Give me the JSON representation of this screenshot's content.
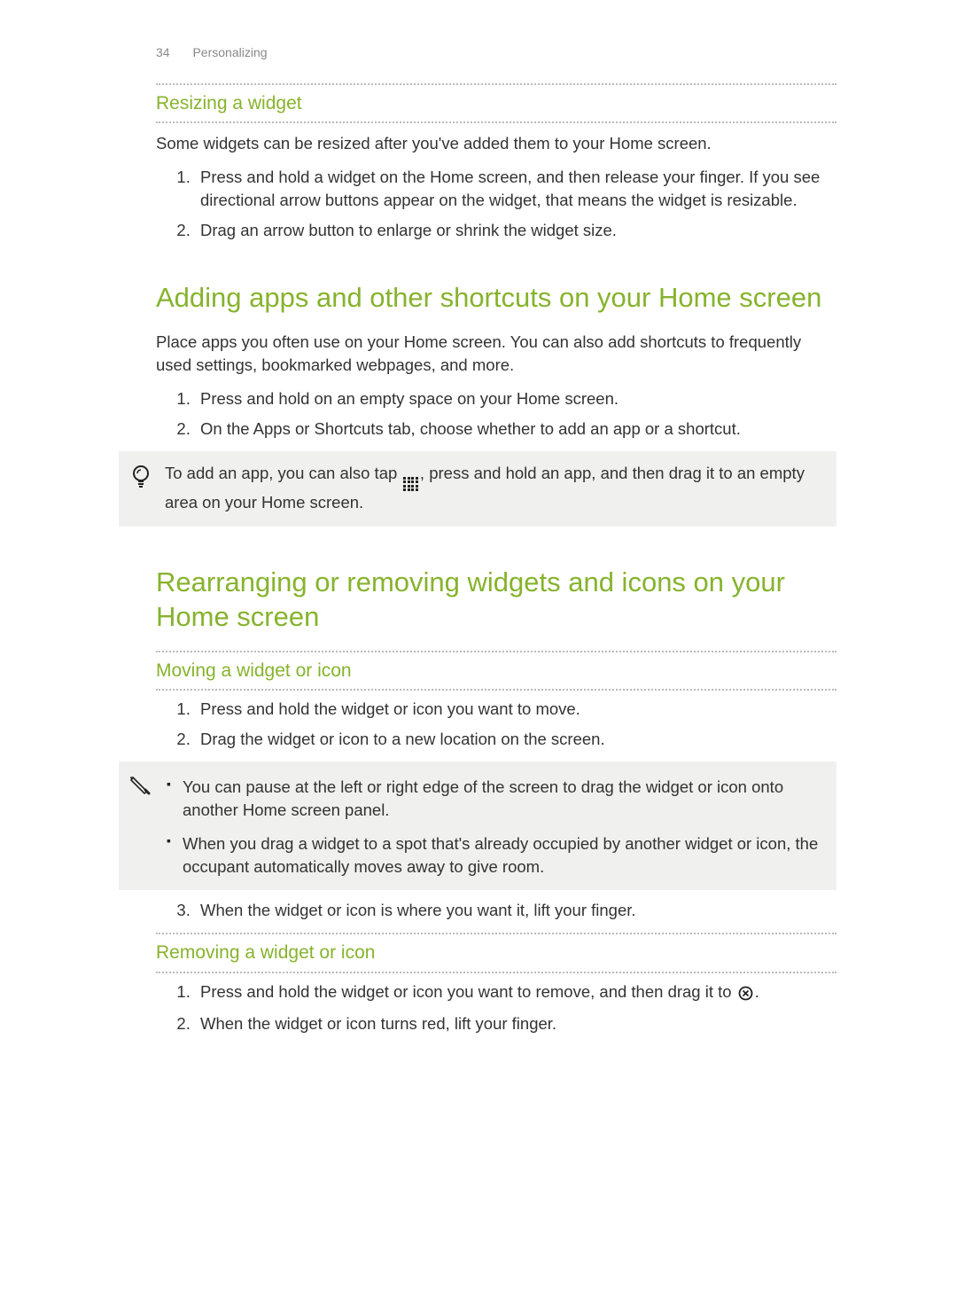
{
  "header": {
    "page_number": "34",
    "section": "Personalizing"
  },
  "resizing": {
    "heading": "Resizing a widget",
    "intro": "Some widgets can be resized after you've added them to your Home screen.",
    "steps": [
      "Press and hold a widget on the Home screen, and then release your finger. If you see directional arrow buttons appear on the widget, that means the widget is resizable.",
      "Drag an arrow button to enlarge or shrink the widget size."
    ]
  },
  "adding": {
    "heading": "Adding apps and other shortcuts on your Home screen",
    "intro": "Place apps you often use on your Home screen. You can also add shortcuts to frequently used settings, bookmarked webpages, and more.",
    "steps": [
      "Press and hold on an empty space on your Home screen.",
      "On the Apps or Shortcuts tab, choose whether to add an app or a shortcut."
    ],
    "tip_pre": "To add an app, you can also tap ",
    "tip_post": ", press and hold an app, and then drag it to an empty area on your Home screen."
  },
  "rearranging": {
    "heading": "Rearranging or removing widgets and icons on your Home screen",
    "moving": {
      "heading": "Moving a widget or icon",
      "steps_a": [
        "Press and hold the widget or icon you want to move.",
        "Drag the widget or icon to a new location on the screen."
      ],
      "notes": [
        "You can pause at the left or right edge of the screen to drag the widget or icon onto another Home screen panel.",
        "When you drag a widget to a spot that's already occupied by another widget or icon, the occupant automatically moves away to give room."
      ],
      "steps_b": [
        "When the widget or icon is where you want it, lift your finger."
      ]
    },
    "removing": {
      "heading": "Removing a widget or icon",
      "step1_pre": "Press and hold the widget or icon you want to remove, and then drag it to ",
      "step1_post": ".",
      "step2": "When the widget or icon turns red, lift your finger."
    }
  }
}
